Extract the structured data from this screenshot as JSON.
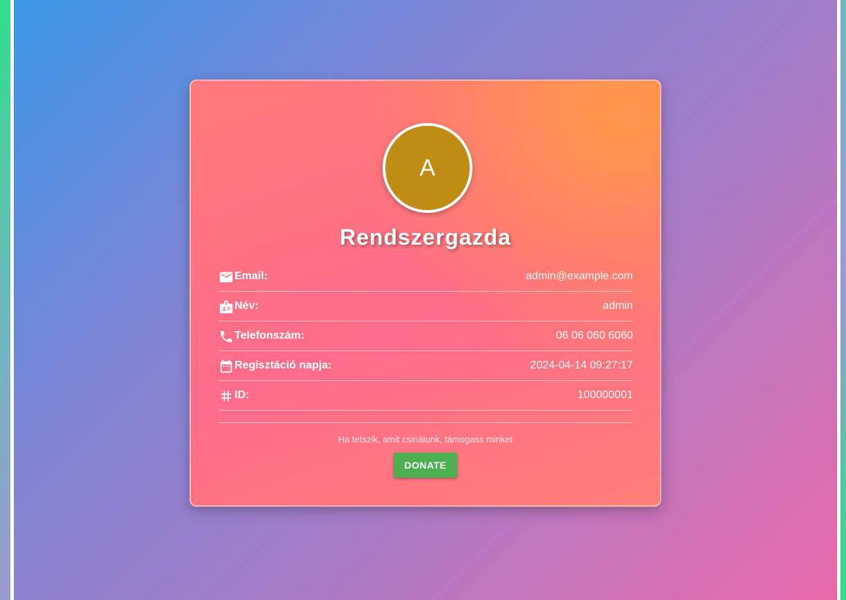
{
  "profile": {
    "avatar_initial": "A",
    "title": "Rendszergazda",
    "avatar_color": "#bf8c14"
  },
  "fields": [
    {
      "icon": "email-icon",
      "label": "Email:",
      "value": "admin@example.com"
    },
    {
      "icon": "id-card-icon",
      "label": "Név:",
      "value": "admin"
    },
    {
      "icon": "phone-icon",
      "label": "Telefonszám:",
      "value": "06 06 060 6060"
    },
    {
      "icon": "calendar-icon",
      "label": "Regisztáció napja:",
      "value": "2024-04-14 09:27:17"
    },
    {
      "icon": "hashtag-icon",
      "label": "ID:",
      "value": "100000001"
    }
  ],
  "support": {
    "text": "Ha tetszik, amit csinálunk, támogass minket",
    "donate_label": "DONATE",
    "donate_color": "#4caf50"
  }
}
